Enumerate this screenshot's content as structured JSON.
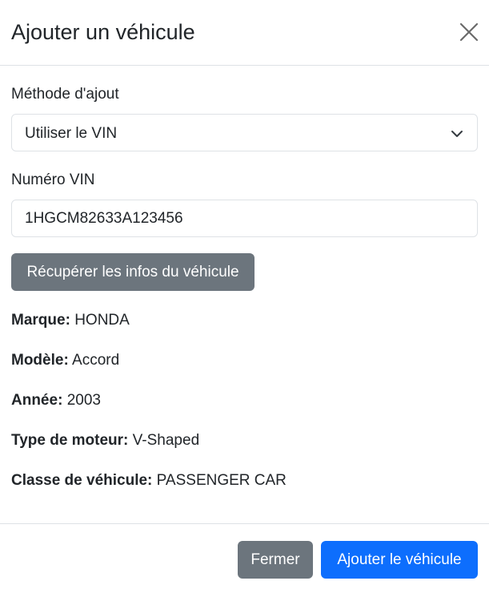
{
  "modal": {
    "title": "Ajouter un véhicule"
  },
  "form": {
    "method_label": "Méthode d'ajout",
    "method_selected": "Utiliser le VIN",
    "vin_label": "Numéro VIN",
    "vin_value": "1HGCM82633A123456",
    "fetch_button": "Récupérer les infos du véhicule"
  },
  "vehicle_info": [
    {
      "label": "Marque:",
      "value": "HONDA"
    },
    {
      "label": "Modèle:",
      "value": "Accord"
    },
    {
      "label": "Année:",
      "value": "2003"
    },
    {
      "label": "Type de moteur:",
      "value": "V-Shaped"
    },
    {
      "label": "Classe de véhicule:",
      "value": "PASSENGER CAR"
    }
  ],
  "footer": {
    "close_button": "Fermer",
    "add_button": "Ajouter le véhicule"
  },
  "icons": {
    "close": "close-icon",
    "dropdown": "chevron-down-icon"
  },
  "colors": {
    "primary": "#0d6efd",
    "secondary": "#6c757d",
    "border": "#dee2e6",
    "text": "#212529"
  }
}
